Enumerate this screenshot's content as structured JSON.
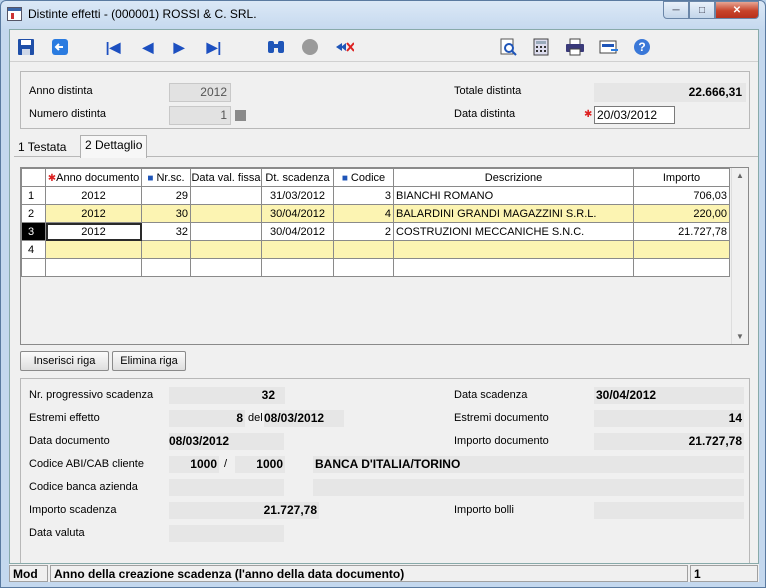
{
  "window": {
    "title": "Distinte effetti  -  (000001) ROSSI & C. SRL."
  },
  "icons": [
    "save-icon",
    "back-icon",
    "first-record-icon",
    "previous-icon",
    "next-icon",
    "last-record-icon",
    "binoculars-icon",
    "circle-icon",
    "delete-filter-icon",
    "preview-icon",
    "calculator-icon",
    "print-icon",
    "export-icon",
    "help-icon"
  ],
  "header": {
    "anno_label": "Anno distinta",
    "anno_value": "2012",
    "numero_label": "Numero distinta",
    "numero_value": "1",
    "totale_label": "Totale distinta",
    "totale_value": "22.666,31",
    "data_label": "Data distinta",
    "data_value": "20/03/2012"
  },
  "tabs": {
    "testata": "1 Testata",
    "dettaglio": "2 Dettaglio"
  },
  "grid": {
    "columns": [
      "Anno documento",
      "Nr.sc.",
      "Data val. fissa",
      "Dt. scadenza",
      "Codice",
      "Descrizione",
      "Importo"
    ],
    "rows": [
      {
        "n": "1",
        "anno": "2012",
        "nrsc": "29",
        "data_val": "",
        "dt_scad": "31/03/2012",
        "codice": "3",
        "descrizione": "BIANCHI ROMANO",
        "importo": "706,03"
      },
      {
        "n": "2",
        "anno": "2012",
        "nrsc": "30",
        "data_val": "",
        "dt_scad": "30/04/2012",
        "codice": "4",
        "descrizione": "BALARDINI GRANDI MAGAZZINI S.R.L.",
        "importo": "220,00"
      },
      {
        "n": "3",
        "anno": "2012",
        "nrsc": "32",
        "data_val": "",
        "dt_scad": "30/04/2012",
        "codice": "2",
        "descrizione": "COSTRUZIONI MECCANICHE S.N.C.",
        "importo": "21.727,78"
      },
      {
        "n": "4",
        "anno": "",
        "nrsc": "",
        "data_val": "",
        "dt_scad": "",
        "codice": "",
        "descrizione": "",
        "importo": ""
      }
    ]
  },
  "buttons": {
    "inserisci": "Inserisci riga",
    "elimina": "Elimina riga"
  },
  "detail": {
    "nr_prog_label": "Nr. progressivo scadenza",
    "nr_prog_value": "32",
    "data_scad_label": "Data scadenza",
    "data_scad_value": "30/04/2012",
    "estremi_eff_label": "Estremi effetto",
    "estremi_eff_num": "8",
    "estremi_eff_del": "del",
    "estremi_eff_date": "08/03/2012",
    "estremi_doc_label": "Estremi documento",
    "estremi_doc_value": "14",
    "data_doc_label": "Data documento",
    "data_doc_value": "08/03/2012",
    "importo_doc_label": "Importo documento",
    "importo_doc_value": "21.727,78",
    "abi_label": "Codice ABI/CAB cliente",
    "abi_value": "1000",
    "abi_sep": "/",
    "cab_value": "1000",
    "banca_value": "BANCA D'ITALIA/TORINO",
    "banca_az_label": "Codice banca azienda",
    "importo_scad_label": "Importo scadenza",
    "importo_scad_value": "21.727,78",
    "importo_bolli_label": "Importo bolli",
    "data_valuta_label": "Data valuta"
  },
  "status": {
    "mode": "Mod",
    "message": "Anno della creazione scadenza (l'anno della data documento)",
    "page": "1"
  }
}
